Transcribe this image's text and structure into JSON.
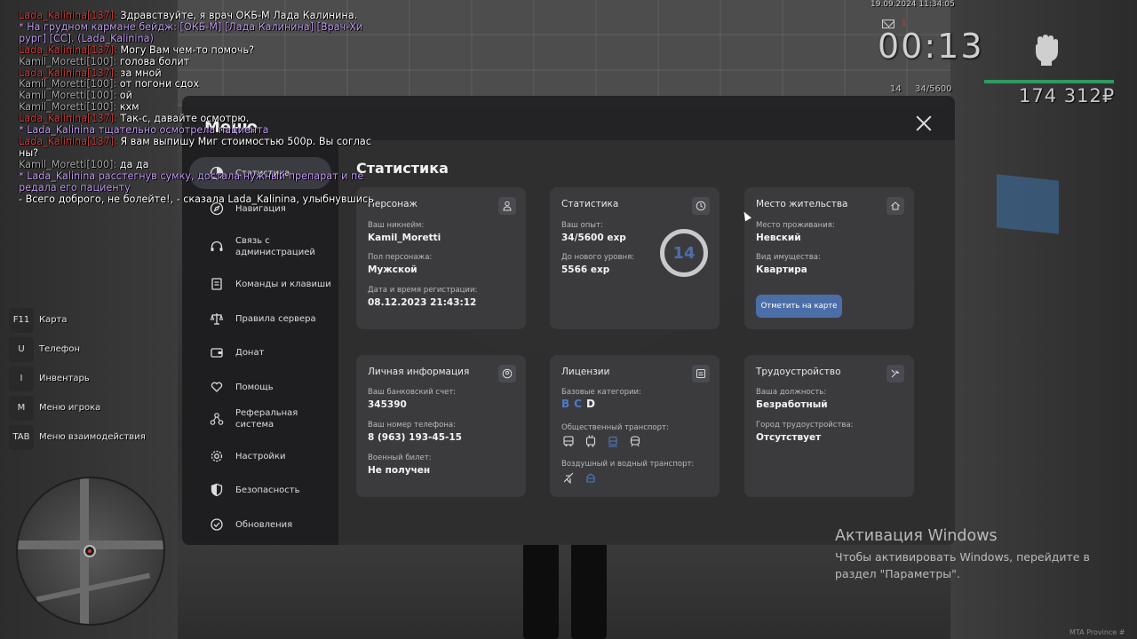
{
  "chat": [
    {
      "color": "red",
      "name": "Lada_Kalinina[137]:",
      "text": " Здравствуйте, я врач ОКБ-М Лада Калинина."
    },
    {
      "color": "purple",
      "name": "",
      "text": "* На грудном кармане бейдж: [ОКБ-М] [Лада Калинина] [Врач-Хи"
    },
    {
      "color": "purple",
      "name": "",
      "text": "рург] [СС]. (Lada_Kalinina)"
    },
    {
      "color": "red",
      "name": "Lada_Kalinina[137]:",
      "text": " Могу Вам чем-то помочь?"
    },
    {
      "color": "grey",
      "name": "Kamil_Moretti[100]:",
      "text": " голова болит"
    },
    {
      "color": "red",
      "name": "Lada_Kalinina[137]:",
      "text": " за мной"
    },
    {
      "color": "grey",
      "name": "Kamil_Moretti[100]:",
      "text": " от погони сдох"
    },
    {
      "color": "grey",
      "name": "Kamil_Moretti[100]:",
      "text": " ой"
    },
    {
      "color": "grey",
      "name": "Kamil_Moretti[100]:",
      "text": " кхм"
    },
    {
      "color": "red",
      "name": "Lada_Kalinina[137]:",
      "text": " Так-с, давайте осмотрю."
    },
    {
      "color": "purple",
      "name": "",
      "text": "* Lada_Kalinina тщательно осмотрела пациента"
    },
    {
      "color": "red",
      "name": "Lada_Kalinina[137]:",
      "text": " Я вам выпишу Миг стоимостью 500р. Вы соглас"
    },
    {
      "color": "white",
      "name": "",
      "text": "ны?"
    },
    {
      "color": "grey",
      "name": "Kamil_Moretti[100]:",
      "text": " да да"
    },
    {
      "color": "purple",
      "name": "",
      "text": "* Lada_Kalinina расстегнув сумку, достала нужный препарат и пе"
    },
    {
      "color": "purple",
      "name": "",
      "text": "редала его пациенту"
    },
    {
      "color": "white",
      "name": "",
      "text": "- Всего доброго, не болейте!, - сказала Lada_Kalinina, улыбнувшись"
    }
  ],
  "hud": {
    "datetime": "19.09.2024 11:34:05",
    "mail_count": "1",
    "time": "00:13",
    "level": "14",
    "exp": "34/5600",
    "money": "174 312₽",
    "health_percent": 100,
    "icons": [
      "mail-icon",
      "fist-icon"
    ]
  },
  "keyhints": [
    {
      "key": "F11",
      "label": "Карта"
    },
    {
      "key": "U",
      "label": "Телефон"
    },
    {
      "key": "I",
      "label": "Инвентарь"
    },
    {
      "key": "M",
      "label": "Меню игрока"
    },
    {
      "key": "TAB",
      "label": "Меню взаимодействия"
    }
  ],
  "menu": {
    "title": "Меню",
    "sidebar": [
      {
        "label": "Статистика",
        "icon": "pie-chart-icon",
        "active": true
      },
      {
        "label": "Навигация",
        "icon": "compass-icon"
      },
      {
        "label": "Связь с администрацией",
        "icon": "headset-icon"
      },
      {
        "label": "Команды и клавиши",
        "icon": "document-icon"
      },
      {
        "label": "Правила сервера",
        "icon": "scales-icon"
      },
      {
        "label": "Донат",
        "icon": "wallet-icon"
      },
      {
        "label": "Помощь",
        "icon": "heart-hands-icon"
      },
      {
        "label": "Реферальная система",
        "icon": "network-icon"
      },
      {
        "label": "Настройки",
        "icon": "gear-icon"
      },
      {
        "label": "Безопасность",
        "icon": "shield-icon"
      },
      {
        "label": "Обновления",
        "icon": "refresh-icon"
      }
    ],
    "content_title": "Статистика",
    "cards": {
      "persona": {
        "title": "Персонаж",
        "icon": "person-icon",
        "nickname_label": "Ваш никнейм:",
        "nickname": "Kamil_Moretti",
        "gender_label": "Пол персонажа:",
        "gender": "Мужской",
        "reg_label": "Дата и время регистрации:",
        "reg": "08.12.2023 21:43:12"
      },
      "stats": {
        "title": "Статистика",
        "icon": "clock-icon",
        "exp_label": "Ваш опыт:",
        "exp": "34/5600 exp",
        "next_label": "До нового уровня:",
        "next": "5566 exp",
        "level": "14"
      },
      "residence": {
        "title": "Место жительства",
        "icon": "house-icon",
        "place_label": "Место проживания:",
        "place": "Невский",
        "property_label": "Вид имущества:",
        "property": "Квартира",
        "button": "Отметить на карте"
      },
      "personal": {
        "title": "Личная информация",
        "icon": "user-circle-icon",
        "bank_label": "Ваш банковский счет:",
        "bank": "345390",
        "phone_label": "Ваш номер телефона:",
        "phone": "8 (963) 193-45-15",
        "military_label": "Военный билет:",
        "military": "Не получен"
      },
      "licenses": {
        "title": "Лицензии",
        "icon": "id-card-icon",
        "base_label": "Базовые категории:",
        "cat_b": "B",
        "cat_c": "C",
        "cat_d": "D",
        "public_label": "Общественный транспорт:",
        "public_icons": [
          "bus-icon",
          "trolleybus-icon",
          "tram-icon",
          "metro-icon"
        ],
        "air_label": "Воздушный и водный транспорт:",
        "air_icons": [
          "plane-icon",
          "boat-icon"
        ]
      },
      "job": {
        "title": "Трудоустройство",
        "icon": "tools-icon",
        "position_label": "Ваша должность:",
        "position": "Безработный",
        "city_label": "Город трудоустройства:",
        "city": "Отсутствует"
      }
    }
  },
  "windows": {
    "title": "Активация Windows",
    "subtitle": "Чтобы активировать Windows, перейдите в раздел \"Параметры\"."
  },
  "footer_tag": "MTA Province #"
}
